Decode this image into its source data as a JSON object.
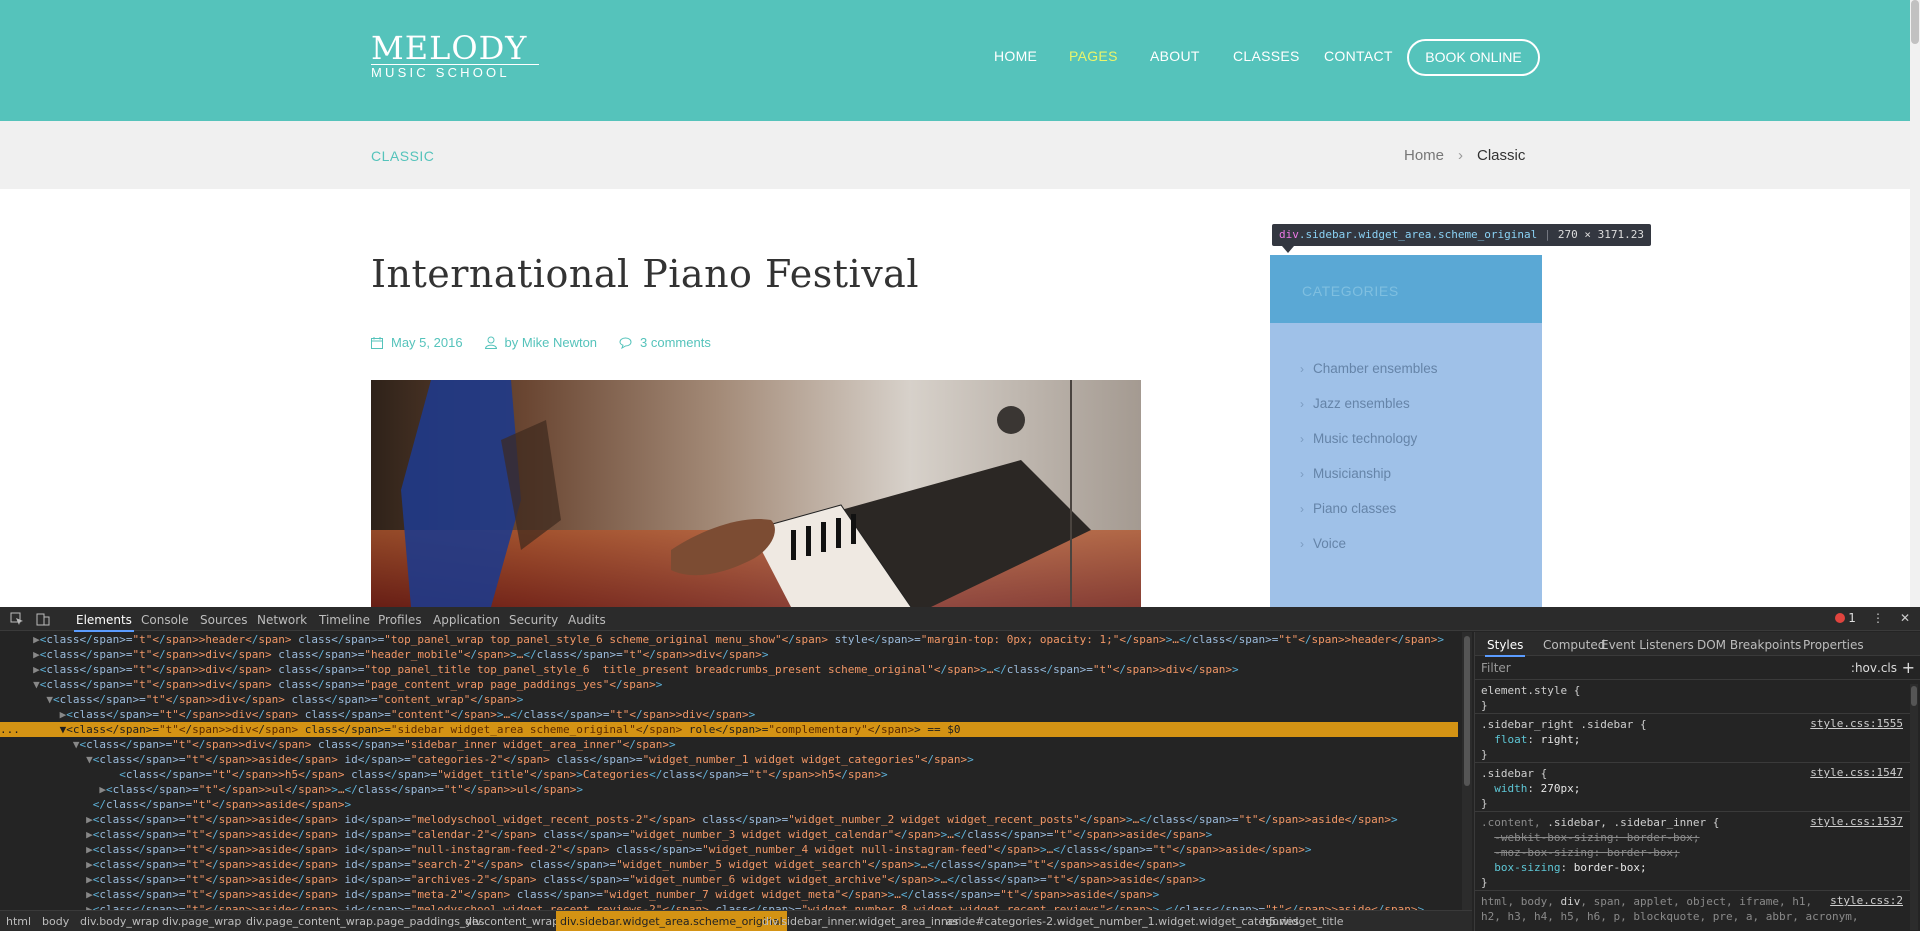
{
  "site": {
    "logo": {
      "line1": "MELODY",
      "line2": "MUSIC SCHOOL"
    },
    "nav": [
      "HOME",
      "PAGES",
      "ABOUT",
      "CLASSES",
      "CONTACT"
    ],
    "nav_active": "PAGES",
    "book_button": "BOOK ONLINE",
    "page_title": "CLASSIC",
    "breadcrumbs": {
      "home": "Home",
      "separator": "›",
      "current": "Classic"
    },
    "post": {
      "title": "International Piano Festival",
      "date": "May 5, 2016",
      "author": "by Mike Newton",
      "comments": "3 comments"
    },
    "sidebar": {
      "widget_title": "CATEGORIES",
      "categories": [
        "Chamber ensembles",
        "Jazz ensembles",
        "Music technology",
        "Musicianship",
        "Piano classes",
        "Voice"
      ]
    },
    "tooltip": {
      "tag": "div",
      "classes": ".sidebar.widget_area.scheme_original",
      "size": "270 × 3171.23"
    },
    "colors": {
      "header": "#55c3bb",
      "nav_active": "#eaf56a",
      "sidebar_highlight": "#9fc1e8"
    }
  },
  "devtools": {
    "tabs": [
      "Elements",
      "Console",
      "Sources",
      "Network",
      "Timeline",
      "Profiles",
      "Application",
      "Security",
      "Audits"
    ],
    "active_tab": "Elements",
    "error_count": "1",
    "dom_lines": [
      {
        "indent": "  ",
        "arrow": "▶",
        "html": "<header class=\"top_panel_wrap top_panel_style_6 scheme_original menu_show\" style=\"margin-top: 0px; opacity: 1;\">…</header>"
      },
      {
        "indent": "  ",
        "arrow": "▶",
        "html": "<div class=\"header_mobile\">…</div>"
      },
      {
        "indent": "  ",
        "arrow": "▶",
        "html": "<div class=\"top_panel_title top_panel_style_6  title_present breadcrumbs_present scheme_original\">…</div>"
      },
      {
        "indent": "  ",
        "arrow": "▼",
        "html": "<div class=\"page_content_wrap page_paddings_yes\">"
      },
      {
        "indent": "    ",
        "arrow": "▼",
        "html": "<div class=\"content_wrap\">"
      },
      {
        "indent": "      ",
        "arrow": "▶",
        "html": "<div class=\"content\">…</div>"
      },
      {
        "indent": "      ",
        "arrow": "▼",
        "html": "<div class=\"sidebar widget_area scheme_original\" role=\"complementary\"> == $0"
      },
      {
        "indent": "        ",
        "arrow": "▼",
        "html": "<div class=\"sidebar_inner widget_area_inner\">"
      },
      {
        "indent": "          ",
        "arrow": "▼",
        "html": "<aside id=\"categories-2\" class=\"widget_number_1 widget widget_categories\">"
      },
      {
        "indent": "              ",
        "arrow": "",
        "html": "<h5 class=\"widget_title\">Categories</h5>"
      },
      {
        "indent": "            ",
        "arrow": "▶",
        "html": "<ul>…</ul>"
      },
      {
        "indent": "          ",
        "arrow": "",
        "html": "</aside>"
      },
      {
        "indent": "          ",
        "arrow": "▶",
        "html": "<aside id=\"melodyschool_widget_recent_posts-2\" class=\"widget_number_2 widget widget_recent_posts\">…</aside>"
      },
      {
        "indent": "          ",
        "arrow": "▶",
        "html": "<aside id=\"calendar-2\" class=\"widget_number_3 widget widget_calendar\">…</aside>"
      },
      {
        "indent": "          ",
        "arrow": "▶",
        "html": "<aside id=\"null-instagram-feed-2\" class=\"widget_number_4 widget null-instagram-feed\">…</aside>"
      },
      {
        "indent": "          ",
        "arrow": "▶",
        "html": "<aside id=\"search-2\" class=\"widget_number_5 widget widget_search\">…</aside>"
      },
      {
        "indent": "          ",
        "arrow": "▶",
        "html": "<aside id=\"archives-2\" class=\"widget_number_6 widget widget_archive\">…</aside>"
      },
      {
        "indent": "          ",
        "arrow": "▶",
        "html": "<aside id=\"meta-2\" class=\"widget_number_7 widget widget_meta\">…</aside>"
      },
      {
        "indent": "          ",
        "arrow": "▶",
        "html": "<aside id=\"melodyschool_widget_recent_reviews-2\" class=\"widget_number_8 widget widget_recent_reviews\">…</aside>"
      }
    ],
    "selected_line": 6,
    "styles_tabs": [
      "Styles",
      "Computed",
      "Event Listeners",
      "DOM Breakpoints",
      "Properties"
    ],
    "filter_placeholder": "Filter",
    "filter_hov": ":hov",
    "filter_cls": ".cls",
    "filter_plus": "+",
    "rules": [
      {
        "selector": "element.style {",
        "decls": [],
        "source": ""
      },
      {
        "selector": ".sidebar_right .sidebar {",
        "decls": [
          {
            "p": "float",
            "v": "right;"
          }
        ],
        "source": "style.css:1555"
      },
      {
        "selector": ".sidebar {",
        "decls": [
          {
            "p": "width",
            "v": "270px;"
          }
        ],
        "source": "style.css:1547"
      },
      {
        "selector": ".content, .sidebar, .sidebar_inner {",
        "decls": [
          {
            "p": "-webkit-box-sizing",
            "v": "border-box;",
            "strike": true
          },
          {
            "p": "-moz-box-sizing",
            "v": "border-box;",
            "strike": true
          },
          {
            "p": "box-sizing",
            "v": "border-box;"
          }
        ],
        "source": "style.css:1537"
      },
      {
        "selector": "html, body, div, span, applet, object, iframe, h1,",
        "selector2": "h2, h3, h4, h5, h6, p, blockquote, pre, a, abbr, acronym,",
        "decls": [],
        "source": "style.css:2"
      }
    ],
    "breadcrumbs": [
      "html",
      "body",
      "div.body_wrap",
      "div.page_wrap",
      "div.page_content_wrap.page_paddings_yes",
      "div.content_wrap",
      "div.sidebar.widget_area.scheme_original",
      "div.sidebar_inner.widget_area_inner",
      "aside#categories-2.widget_number_1.widget.widget_categories",
      "h5.widget_title"
    ],
    "breadcrumb_active": 6
  }
}
